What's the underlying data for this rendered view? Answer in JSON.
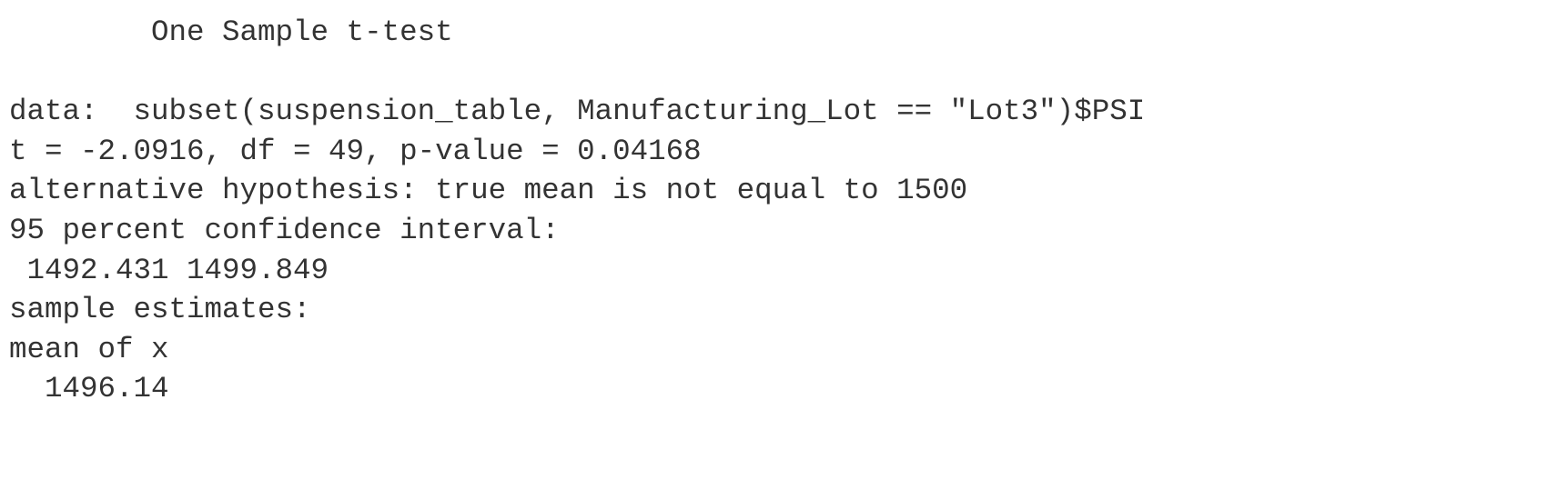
{
  "output": {
    "title": "        One Sample t-test",
    "blank1": "",
    "data_line": "data:  subset(suspension_table, Manufacturing_Lot == \"Lot3\")$PSI",
    "stats_line": "t = -2.0916, df = 49, p-value = 0.04168",
    "alt_line": "alternative hypothesis: true mean is not equal to 1500",
    "ci_label": "95 percent confidence interval:",
    "ci_values": " 1492.431 1499.849",
    "estimates_label": "sample estimates:",
    "mean_label": "mean of x",
    "mean_value": "  1496.14"
  }
}
